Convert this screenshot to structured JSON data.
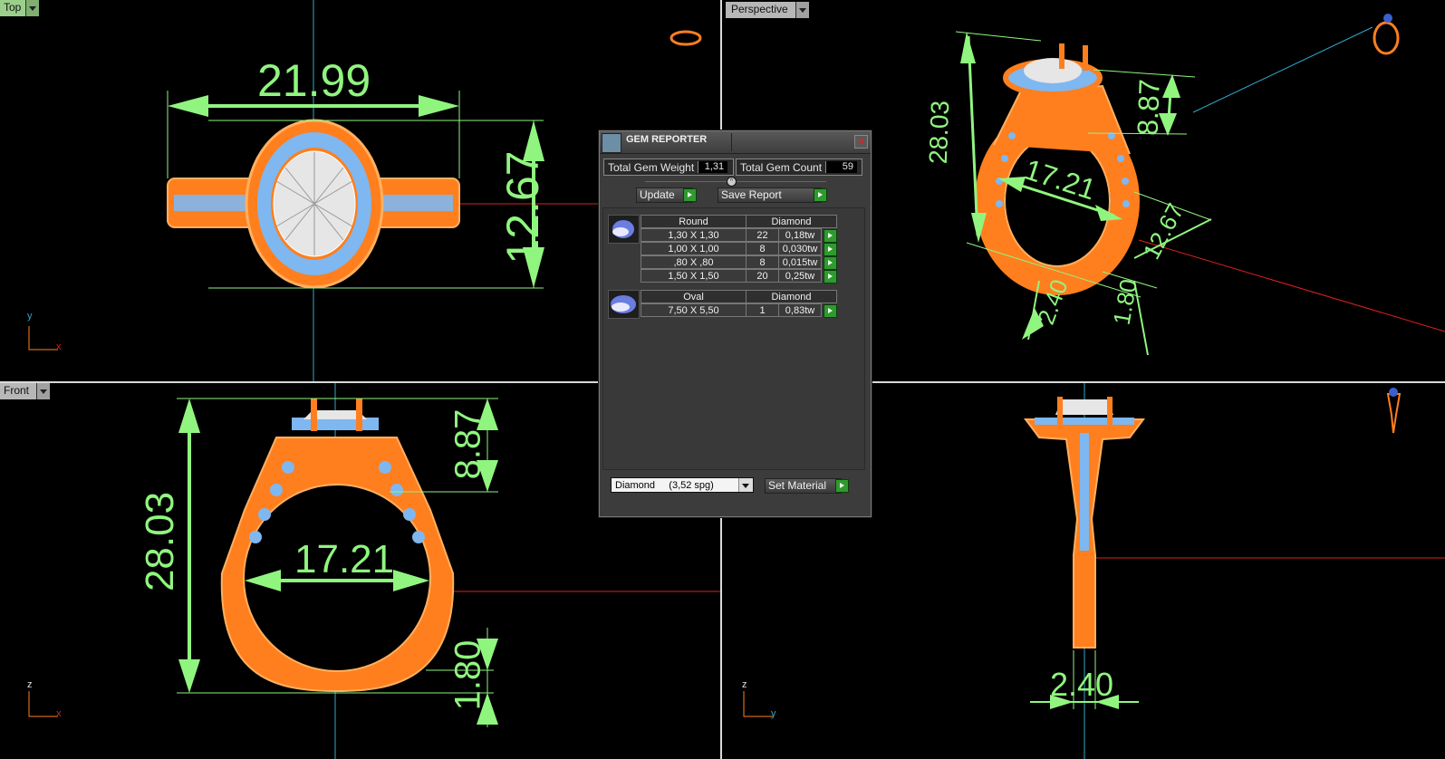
{
  "viewports": {
    "top": {
      "label": "Top",
      "axis_h": "x",
      "axis_v": "y"
    },
    "perspective": {
      "label": "Perspective"
    },
    "front": {
      "label": "Front",
      "axis_h": "x",
      "axis_v": "z"
    },
    "right": {
      "axis_h": "y",
      "axis_v": "z"
    }
  },
  "dimensions": {
    "top_width": "21.99",
    "top_height": "12.67",
    "front_height": "28.03",
    "front_inner": "17.21",
    "front_head": "8.87",
    "front_shank": "1.80",
    "persp_height": "28.03",
    "persp_head": "8.87",
    "persp_inner": "17.21",
    "persp_width": "12.67",
    "persp_shank": "1.80",
    "persp_band": "2.40",
    "right_band": "2.40"
  },
  "gem_reporter": {
    "title": "GEM REPORTER",
    "close_label": "x",
    "total_weight_label": "Total Gem Weight",
    "total_weight_value": "1,31",
    "total_count_label": "Total Gem Count",
    "total_count_value": "59",
    "collapse_glyph": "^",
    "update_label": "Update",
    "save_label": "Save Report",
    "groups": [
      {
        "shape": "Round",
        "material": "Diamond",
        "rows": [
          {
            "size": "1,30 X 1,30",
            "count": "22",
            "weight": "0,18tw"
          },
          {
            "size": "1,00 X 1,00",
            "count": "8",
            "weight": "0,030tw"
          },
          {
            "size": ",80 X ,80",
            "count": "8",
            "weight": "0,015tw"
          },
          {
            "size": "1,50 X 1,50",
            "count": "20",
            "weight": "0,25tw"
          }
        ]
      },
      {
        "shape": "Oval",
        "material": "Diamond",
        "rows": [
          {
            "size": "7,50 X 5,50",
            "count": "1",
            "weight": "0,83tw"
          }
        ]
      }
    ],
    "material_select": "Diamond     (3,52 spg)",
    "set_material_label": "Set Material"
  },
  "colors": {
    "ring": "#ff7f1e",
    "gem_blue": "#7fb7f0",
    "dimension": "#90f57f",
    "axis_x": "#e02020",
    "axis_y": "#2fa7c8",
    "background": "#000000"
  }
}
